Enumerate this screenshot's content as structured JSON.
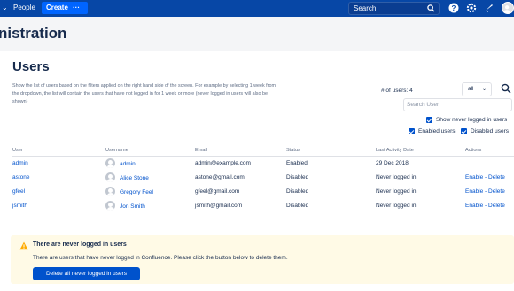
{
  "topbar": {
    "people": "People",
    "create": "Create",
    "more": "···",
    "search_placeholder": "Search"
  },
  "header": {
    "title": "nistration"
  },
  "users": {
    "title": "Users",
    "description": "Show the list of users based on the filters applied on the right hand side of the screen. For example by selecting 1 week from the dropdown, the list will contain the users that have not logged in for 1 week or more (never logged in users will also be shown)",
    "count_label": "# of users: 4",
    "period_value": "all",
    "search_placeholder": "Search User",
    "show_never_label": "Show never logged in users",
    "enabled_label": "Enabled users",
    "disabled_label": "Disabled users"
  },
  "table": {
    "headers": [
      "User",
      "Username",
      "Email",
      "Status",
      "Last Activity Date",
      "Actions"
    ],
    "rows": [
      {
        "user": "admin",
        "username": "admin",
        "email": "admin@example.com",
        "status": "Enabled",
        "last": "29 Dec 2018",
        "actions": ""
      },
      {
        "user": "astone",
        "username": "Alice Stone",
        "email": "astone@gmail.com",
        "status": "Disabled",
        "last": "Never logged in",
        "actions": "Enable - Delete"
      },
      {
        "user": "gfeel",
        "username": "Gregory Feel",
        "email": "gfeel@gmail.com",
        "status": "Disabled",
        "last": "Never logged in",
        "actions": "Enable - Delete"
      },
      {
        "user": "jsmith",
        "username": "Jon Smith",
        "email": "jsmith@gmail.com",
        "status": "Disabled",
        "last": "Never logged in",
        "actions": "Enable - Delete"
      }
    ]
  },
  "warning": {
    "title": "There are never logged in users",
    "text": "There are users that have never logged in Confluence. Please click the button below to delete them.",
    "button": "Delete all never logged in users"
  },
  "colors": {
    "topbar": "#0747a6",
    "create": "#0065ff",
    "link": "#0052cc",
    "warning_bg": "#fffae6",
    "warning_icon": "#ffab00"
  },
  "icons": [
    "chevron-down-icon",
    "search-icon",
    "help-icon",
    "settings-icon",
    "notifications-icon",
    "avatar",
    "warning-icon",
    "user-avatar-icon",
    "checkbox-checked-icon"
  ]
}
